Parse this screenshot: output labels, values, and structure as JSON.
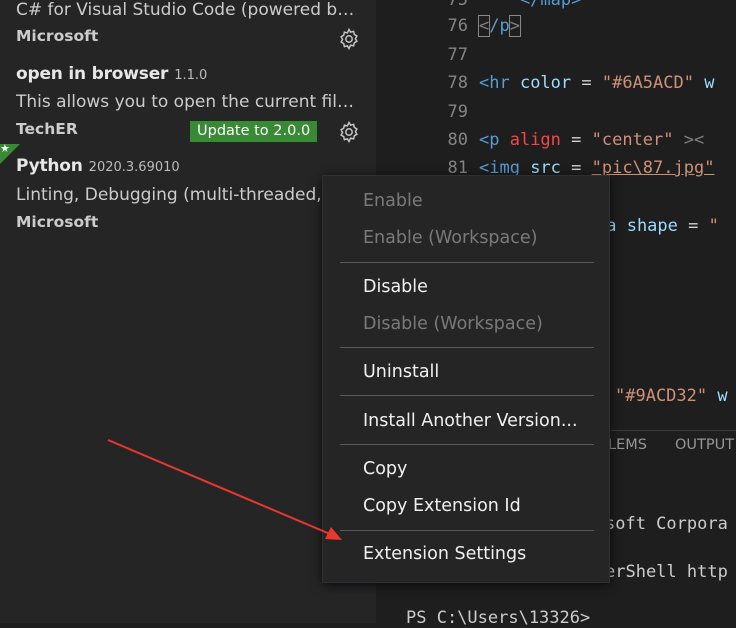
{
  "extensions": [
    {
      "name": "",
      "version": "",
      "description": "C# for Visual Studio Code (powered by OmniSharp).",
      "publisher": "Microsoft"
    },
    {
      "name": "open in browser",
      "version": "1.1.0",
      "description": "This allows you to open the current file in your default browser",
      "publisher": "TechER",
      "update_label": "Update to 2.0.0"
    },
    {
      "name": "Python",
      "version": "2020.3.69010",
      "description": "Linting, Debugging (multi-threaded, remote), Intellisense, code formatting",
      "publisher": "Microsoft"
    }
  ],
  "editor": {
    "lines": [
      {
        "num": "",
        "tokens": []
      },
      {
        "num": "76",
        "tokens": []
      },
      {
        "num": "77",
        "tokens": []
      },
      {
        "num": "78",
        "tokens": []
      },
      {
        "num": "79",
        "tokens": []
      },
      {
        "num": "80",
        "tokens": []
      },
      {
        "num": "81",
        "tokens": []
      }
    ],
    "line75_text": "    </map>",
    "line76_open": "<",
    "line76_tag": "/p",
    "line76_close": ">",
    "line78_tag": "<hr",
    "line78_attr": " color",
    "line78_eq": " = ",
    "line78_str": "\"#6A5ACD\"",
    "line78_rest": " w",
    "line80_tag": "<p",
    "line80_attr": " align",
    "line80_eq": " = ",
    "line80_str": "\"center\"",
    "line80_rest": " ><",
    "line81_tag": "<img",
    "line81_attr": " src",
    "line81_eq": " = ",
    "line81_str": "\"pic\\87.jpg\"",
    "line83_attr": "ea shape",
    "line83_eq": " = ",
    "line83_str": "\"",
    "line_hidden_str": "\"#9ACD32\"",
    "line_hidden_rest": " w"
  },
  "panel": {
    "tabs": [
      "LEMS",
      "OUTPUT"
    ],
    "terminal_lines": [
      "soft Corpora",
      "erShell http",
      "PS C:\\Users\\13326>"
    ]
  },
  "context_menu": {
    "items": [
      {
        "label": "Enable",
        "enabled": false
      },
      {
        "label": "Enable (Workspace)",
        "enabled": false
      },
      {
        "label": "Disable",
        "enabled": true
      },
      {
        "label": "Disable (Workspace)",
        "enabled": false
      },
      {
        "label": "Uninstall",
        "enabled": true
      },
      {
        "label": "Install Another Version...",
        "enabled": true
      },
      {
        "label": "Copy",
        "enabled": true
      },
      {
        "label": "Copy Extension Id",
        "enabled": true
      },
      {
        "label": "Extension Settings",
        "enabled": true
      }
    ]
  },
  "colors": {
    "update_button": "#388a34",
    "arrow": "#e8382e",
    "sidebar_bg": "#252526",
    "editor_bg": "#1e1e1e"
  }
}
